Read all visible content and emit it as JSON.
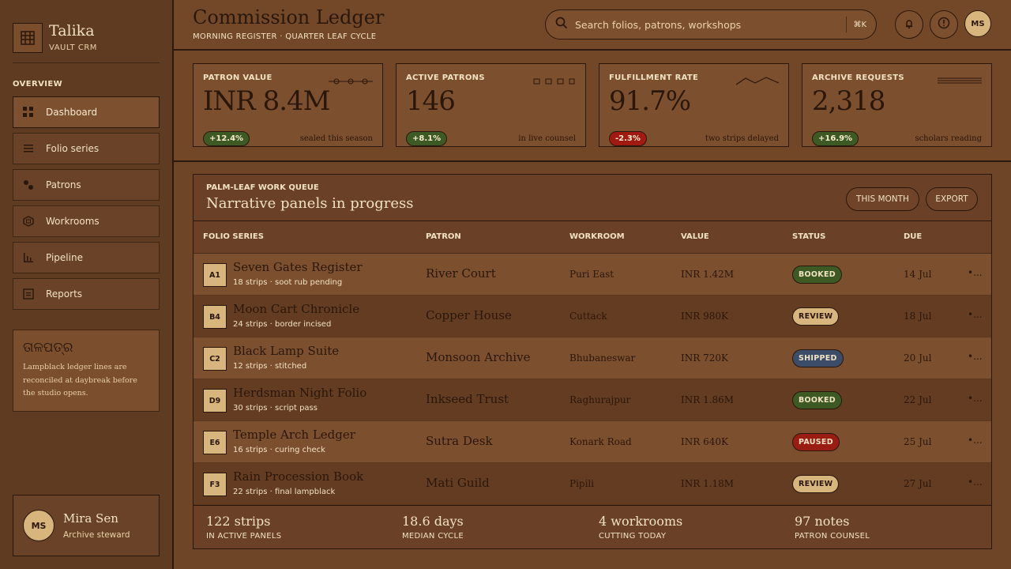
{
  "brand": {
    "name": "Talika",
    "sub": "VAULT CRM"
  },
  "sidebar": {
    "section": "OVERVIEW",
    "items": [
      {
        "label": "Dashboard",
        "icon": "grid-icon",
        "active": true
      },
      {
        "label": "Folio series",
        "icon": "list-icon"
      },
      {
        "label": "Patrons",
        "icon": "people-icon"
      },
      {
        "label": "Workrooms",
        "icon": "hexagon-icon"
      },
      {
        "label": "Pipeline",
        "icon": "bar-chart-icon"
      },
      {
        "label": "Reports",
        "icon": "report-icon"
      }
    ],
    "note": {
      "title": "ତାଳପତ୍ର",
      "text": "Lampblack ledger lines are reconciled at daybreak before the studio opens."
    },
    "user": {
      "initials": "MS",
      "name": "Mira Sen",
      "role": "Archive steward"
    }
  },
  "header": {
    "title": "Commission Ledger",
    "subtitle": "MORNING REGISTER · QUARTER LEAF CYCLE",
    "search_placeholder": "Search folios, patrons, workshops",
    "search_shortcut": "⌘K",
    "avatar_initials": "MS"
  },
  "kpis": [
    {
      "label": "PATRON VALUE",
      "value": "INR 8.4M",
      "delta": "+12.4%",
      "trend": "up",
      "note": "sealed this season"
    },
    {
      "label": "ACTIVE PATRONS",
      "value": "146",
      "delta": "+8.1%",
      "trend": "up",
      "note": "in live counsel"
    },
    {
      "label": "FULFILLMENT RATE",
      "value": "91.7%",
      "delta": "-2.3%",
      "trend": "down",
      "note": "two strips delayed"
    },
    {
      "label": "ARCHIVE REQUESTS",
      "value": "2,318",
      "delta": "+16.9%",
      "trend": "up",
      "note": "scholars reading"
    }
  ],
  "queue": {
    "eyebrow": "PALM-LEAF WORK QUEUE",
    "title": "Narrative panels in progress",
    "buttons": {
      "month": "THIS MONTH",
      "export": "EXPORT"
    },
    "columns": [
      "FOLIO SERIES",
      "PATRON",
      "WORKROOM",
      "VALUE",
      "STATUS",
      "DUE"
    ],
    "rows": [
      {
        "code": "A1",
        "title": "Seven Gates Register",
        "sub": "18 strips · soot rub pending",
        "patron": "River Court",
        "workroom": "Puri East",
        "value": "INR 1.42M",
        "status": "BOOKED",
        "due": "14 Jul",
        "more": "•..."
      },
      {
        "code": "B4",
        "title": "Moon Cart Chronicle",
        "sub": "24 strips · border incised",
        "patron": "Copper House",
        "workroom": "Cuttack",
        "value": "INR 980K",
        "status": "REVIEW",
        "due": "18 Jul",
        "more": "•..."
      },
      {
        "code": "C2",
        "title": "Black Lamp Suite",
        "sub": "12 strips · stitched",
        "patron": "Monsoon Archive",
        "workroom": "Bhubaneswar",
        "value": "INR 720K",
        "status": "SHIPPED",
        "due": "20 Jul",
        "more": "•..."
      },
      {
        "code": "D9",
        "title": "Herdsman Night Folio",
        "sub": "30 strips · script pass",
        "patron": "Inkseed Trust",
        "workroom": "Raghurajpur",
        "value": "INR 1.86M",
        "status": "BOOKED",
        "due": "22 Jul",
        "more": "•..."
      },
      {
        "code": "E6",
        "title": "Temple Arch Ledger",
        "sub": "16 strips · curing check",
        "patron": "Sutra Desk",
        "workroom": "Konark Road",
        "value": "INR 640K",
        "status": "PAUSED",
        "due": "25 Jul",
        "more": "•..."
      },
      {
        "code": "F3",
        "title": "Rain Procession Book",
        "sub": "22 strips · final lampblack",
        "patron": "Mati Guild",
        "workroom": "Pipili",
        "value": "INR 1.18M",
        "status": "REVIEW",
        "due": "27 Jul",
        "more": "•..."
      }
    ],
    "footer": [
      {
        "value": "122 strips",
        "label": "IN ACTIVE PANELS"
      },
      {
        "value": "18.6 days",
        "label": "MEDIAN CYCLE"
      },
      {
        "value": "4 workrooms",
        "label": "CUTTING TODAY"
      },
      {
        "value": "97 notes",
        "label": "PATRON COUNSEL"
      }
    ]
  },
  "colors": {
    "background": "#6e4527",
    "ink": "#2a170b",
    "parchment": "#f1e2c2",
    "booked": "#3d5a24",
    "review": "#d8b57c",
    "shipped": "#3b4d68",
    "paused": "#9a1d14"
  }
}
